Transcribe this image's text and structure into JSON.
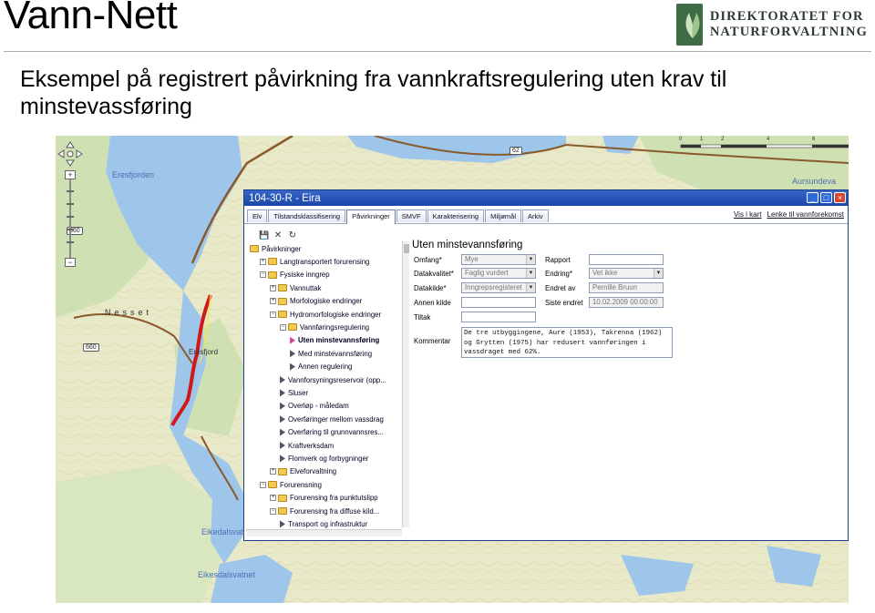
{
  "slide": {
    "title": "Vann-Nett",
    "subtitle": "Eksempel på registrert påvirkning fra vannkraftsregulering uten krav til minstevassføring",
    "logo_line1": "DIREKTORATET FOR",
    "logo_line2": "NATURFORVALTNING"
  },
  "map": {
    "labels": [
      "Eresfjorden",
      "Nesset",
      "Eresfjord",
      "Eikedalsvat",
      "Eikesdalsvatnet",
      "Aursundeva"
    ],
    "road_badges": [
      "660",
      "62",
      "660"
    ],
    "scale_labels": [
      "0",
      "1",
      "2",
      "4",
      "6"
    ],
    "zoom_plus": "+",
    "zoom_minus": "−"
  },
  "window": {
    "title": "104-30-R - Eira",
    "buttons": {
      "minimize": "_",
      "maximize": "□",
      "close": "×"
    },
    "tabs": [
      {
        "label": "Elv",
        "active": false
      },
      {
        "label": "Tilstandsklassifisering",
        "active": false
      },
      {
        "label": "Påvirkninger",
        "active": true
      },
      {
        "label": "SMVF",
        "active": false
      },
      {
        "label": "Karakterisering",
        "active": false
      },
      {
        "label": "Miljømål",
        "active": false
      },
      {
        "label": "Arkiv",
        "active": false
      }
    ],
    "links": {
      "map": "Vis i kart",
      "coverage": "Lenke til vannforekomst"
    },
    "toolbar": {
      "save": "💾",
      "delete": "✕",
      "refresh": "↻"
    }
  },
  "tree": [
    {
      "label": "Påvirkninger",
      "level": 0,
      "type": "folder",
      "exp": ""
    },
    {
      "label": "Langtransportert forurensing",
      "level": 1,
      "type": "folder",
      "exp": "+"
    },
    {
      "label": "Fysiske inngrep",
      "level": 1,
      "type": "folder",
      "exp": "−"
    },
    {
      "label": "Vannuttak",
      "level": 2,
      "type": "folder",
      "exp": "+"
    },
    {
      "label": "Morfologiske endringer",
      "level": 2,
      "type": "folder",
      "exp": "+"
    },
    {
      "label": "Hydromorfologiske endringer",
      "level": 2,
      "type": "folder",
      "exp": "−"
    },
    {
      "label": "Vannføringsregulering",
      "level": 3,
      "type": "folder",
      "exp": "−"
    },
    {
      "label": "Uten minstevannsføring",
      "level": 4,
      "type": "leaf",
      "selected": true
    },
    {
      "label": "Med minstevannsføring",
      "level": 4,
      "type": "leaf"
    },
    {
      "label": "Annen regulering",
      "level": 4,
      "type": "leaf"
    },
    {
      "label": "Vannforsyningsreservoir (opp...",
      "level": 3,
      "type": "leaf"
    },
    {
      "label": "Sluser",
      "level": 3,
      "type": "leaf"
    },
    {
      "label": "Overløp - måledam",
      "level": 3,
      "type": "leaf"
    },
    {
      "label": "Overføringer mellom vassdrag",
      "level": 3,
      "type": "leaf"
    },
    {
      "label": "Overføring til grunnvannsres...",
      "level": 3,
      "type": "leaf"
    },
    {
      "label": "Kraftverksdam",
      "level": 3,
      "type": "leaf"
    },
    {
      "label": "Flomverk og forbygninger",
      "level": 3,
      "type": "leaf"
    },
    {
      "label": "Elveforvaltning",
      "level": 2,
      "type": "folder",
      "exp": "+"
    },
    {
      "label": "Forurensning",
      "level": 1,
      "type": "folder",
      "exp": "−"
    },
    {
      "label": "Forurensing fra punktutslipp",
      "level": 2,
      "type": "folder",
      "exp": "+"
    },
    {
      "label": "Forurensing fra diffuse kild...",
      "level": 2,
      "type": "folder",
      "exp": "−"
    },
    {
      "label": "Transport og infrastruktur",
      "level": 3,
      "type": "leaf"
    }
  ],
  "form": {
    "heading": "Uten minstevannsføring",
    "omfang": {
      "label": "Omfang*",
      "value": "Mye"
    },
    "datakvalitet": {
      "label": "Datakvalitet*",
      "value": "Faglig vurdert"
    },
    "datakilde": {
      "label": "Datakilde*",
      "value": "Inngrepsregisteret"
    },
    "annen_kilde": {
      "label": "Annen kilde",
      "value": ""
    },
    "tiltak": {
      "label": "Tiltak",
      "value": ""
    },
    "kommentar": {
      "label": "Kommentar",
      "value": "De tre utbyggingene, Aure (1953), Takrenna (1962) og Grytten (1975) har redusert vannføringen i vassdraget med 62%."
    },
    "rapport": {
      "label": "Rapport",
      "value": ""
    },
    "endring": {
      "label": "Endring*",
      "value": "Vet ikke"
    },
    "endret_av": {
      "label": "Endret av",
      "value": "Pernille Bruun"
    },
    "siste_endret": {
      "label": "Siste endret",
      "value": "10.02.2009 00:00:00"
    }
  },
  "colors": {
    "titlebar": "#1a46a8",
    "river_highlight": "#d11818",
    "water": "#9ec6ea",
    "terrain": "#e8ebcf"
  }
}
